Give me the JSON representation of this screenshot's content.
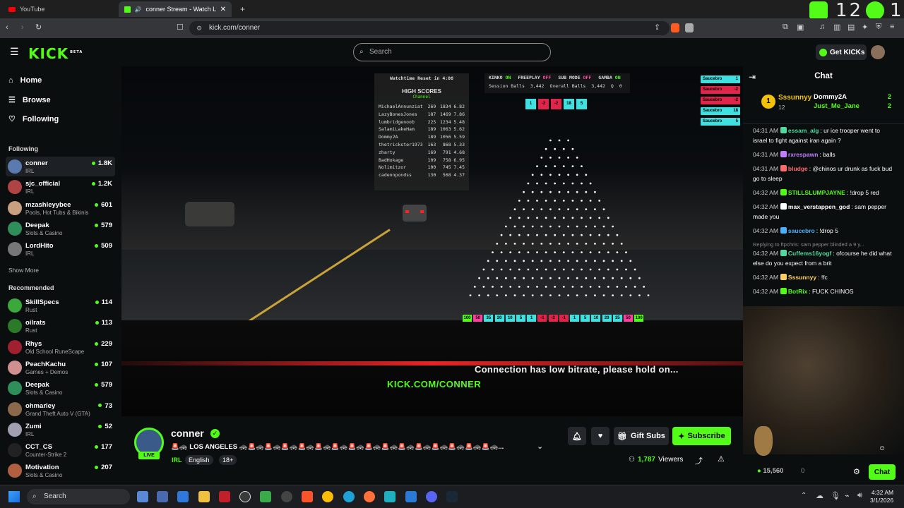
{
  "browser": {
    "tabs": [
      {
        "title": "YouTube"
      },
      {
        "title": "conner Stream - Watch Live o"
      }
    ],
    "new_tab": "+",
    "url": "kick.com/conner",
    "corner_counts": [
      "12",
      "1"
    ]
  },
  "kick": {
    "logo": "KICK",
    "beta": "BETA",
    "search_placeholder": "Search",
    "get_kicks": "Get KICKs"
  },
  "sidebar": {
    "nav": [
      {
        "label": "Home"
      },
      {
        "label": "Browse"
      },
      {
        "label": "Following"
      }
    ],
    "following_title": "Following",
    "following": [
      {
        "name": "conner",
        "category": "IRL",
        "viewers": "1.8K",
        "color": "#5a7ab0"
      },
      {
        "name": "sjc_official",
        "category": "IRL",
        "viewers": "1.2K",
        "color": "#b04444"
      },
      {
        "name": "mzashleyybee",
        "category": "Pools, Hot Tubs & Bikinis",
        "viewers": "601",
        "color": "#c8a080"
      },
      {
        "name": "Deepak",
        "category": "Slots & Casino",
        "viewers": "579",
        "color": "#2e8f5a"
      },
      {
        "name": "LordHito",
        "category": "IRL",
        "viewers": "509",
        "color": "#777"
      }
    ],
    "show_more": "Show More",
    "recommended_title": "Recommended",
    "recommended": [
      {
        "name": "SkillSpecs",
        "category": "Rust",
        "viewers": "114",
        "color": "#3aa83a"
      },
      {
        "name": "oilrats",
        "category": "Rust",
        "viewers": "113",
        "color": "#2a7a2a"
      },
      {
        "name": "Rhys",
        "category": "Old School RuneScape",
        "viewers": "229",
        "color": "#a02030"
      },
      {
        "name": "PeachKachu",
        "category": "Games + Demos",
        "viewers": "107",
        "color": "#d09090"
      },
      {
        "name": "Deepak",
        "category": "Slots & Casino",
        "viewers": "579",
        "color": "#2e8f5a"
      },
      {
        "name": "ohmarley",
        "category": "Grand Theft Auto V (GTA)",
        "viewers": "73",
        "color": "#8a6a4a"
      },
      {
        "name": "Zumi",
        "category": "IRL",
        "viewers": "52",
        "color": "#a0a0b0"
      },
      {
        "name": "CCT_CS",
        "category": "Counter-Strike 2",
        "viewers": "177",
        "color": "#222"
      },
      {
        "name": "Motivation",
        "category": "Slots & Casino",
        "viewers": "207",
        "color": "#b06040"
      }
    ]
  },
  "video": {
    "watchtime": "Watchtime Reset in 4:08",
    "flags": [
      {
        "label": "KINKO",
        "state": "ON",
        "color": "#53fc18"
      },
      {
        "label": "FREEPLAY",
        "state": "OFF",
        "color": "#ff4aa0"
      },
      {
        "label": "SUB MODE",
        "state": "OFF",
        "color": "#ff4aa0"
      },
      {
        "label": "GAMBA",
        "state": "ON",
        "color": "#53fc18"
      }
    ],
    "session_balls_label": "Session Balls",
    "session_balls": "3,442",
    "overall_balls_label": "Overall Balls",
    "overall_balls": "3,442",
    "q_label": "Q",
    "q_value": "0",
    "high_scores_title": "HIGH SCORES",
    "high_scores_sub": "Channel",
    "high_scores": [
      {
        "name": "MichaelAnnunziat",
        "a": "269",
        "b": "1834",
        "c": "6.82"
      },
      {
        "name": "LazyBonesJones",
        "a": "187",
        "b": "1469",
        "c": "7.86"
      },
      {
        "name": "lumbridgenoob",
        "a": "225",
        "b": "1234",
        "c": "5.48"
      },
      {
        "name": "SalamiLakeHam",
        "a": "189",
        "b": "1063",
        "c": "5.62"
      },
      {
        "name": "Dommy2A",
        "a": "189",
        "b": "1056",
        "c": "5.59"
      },
      {
        "name": "thetrickster1973",
        "a": "163",
        "b": "868",
        "c": "5.33"
      },
      {
        "name": "zharty",
        "a": "169",
        "b": "791",
        "c": "4.68"
      },
      {
        "name": "BadHokage",
        "a": "109",
        "b": "758",
        "c": "6.95"
      },
      {
        "name": "Nolimitzor",
        "a": "100",
        "b": "745",
        "c": "7.45"
      },
      {
        "name": "cadennpondss",
        "a": "130",
        "b": "568",
        "c": "4.37"
      }
    ],
    "drop_chips": [
      {
        "v": "1",
        "color": "#3ee0e0"
      },
      {
        "v": "-2",
        "color": "#e0244a"
      },
      {
        "v": "-2",
        "color": "#e0244a"
      },
      {
        "v": "18",
        "color": "#3ee0e0"
      },
      {
        "v": "5",
        "color": "#3ee0e0"
      }
    ],
    "recent": [
      {
        "name": "Saucebro",
        "v": "1",
        "color": "#3ee0e0"
      },
      {
        "name": "Saucebro",
        "v": "-2",
        "color": "#e0244a"
      },
      {
        "name": "Saucebro",
        "v": "-2",
        "color": "#e0244a"
      },
      {
        "name": "Saucebro",
        "v": "18",
        "color": "#3ee0e0"
      },
      {
        "name": "Saucebro",
        "v": "5",
        "color": "#3ee0e0"
      }
    ],
    "slots": [
      {
        "v": "100",
        "color": "#53fc18"
      },
      {
        "v": "50",
        "color": "#ff3fa0"
      },
      {
        "v": "35",
        "color": "#3ee0e0"
      },
      {
        "v": "20",
        "color": "#3ee0e0"
      },
      {
        "v": "10",
        "color": "#3ee0e0"
      },
      {
        "v": "5",
        "color": "#3ee0e0"
      },
      {
        "v": "1",
        "color": "#3ee0e0"
      },
      {
        "v": "-1",
        "color": "#e0244a"
      },
      {
        "v": "-2",
        "color": "#e0244a"
      },
      {
        "v": "-1",
        "color": "#e0244a"
      },
      {
        "v": "1",
        "color": "#3ee0e0"
      },
      {
        "v": "5",
        "color": "#3ee0e0"
      },
      {
        "v": "10",
        "color": "#3ee0e0"
      },
      {
        "v": "20",
        "color": "#3ee0e0"
      },
      {
        "v": "35",
        "color": "#3ee0e0"
      },
      {
        "v": "50",
        "color": "#ff3fa0"
      },
      {
        "v": "100",
        "color": "#53fc18"
      }
    ],
    "status_text": "Connection has low bitrate, please hold on...",
    "watermark": "KICK.COM/CONNER"
  },
  "channel": {
    "name": "conner",
    "live": "LIVE",
    "title": "🚨🚓 LOS ANGELES 🚓🚨🚓🚨🚓🚨🚓🚨🚓🚨🚓🚨🚓🚨🚓🚨🚓🚨🚓🚨🚓🚨🚓🚨🚓🚨🚓🚨🚓🚨🚓...",
    "tags": [
      "IRL",
      "English",
      "18+"
    ],
    "viewers": "1,787",
    "viewers_label": "Viewers",
    "gift_subs": "Gift Subs",
    "subscribe": "Subscribe"
  },
  "chat": {
    "title": "Chat",
    "leader": {
      "rank": "1",
      "name": "Sssunnyy",
      "count": "12"
    },
    "gifters": [
      {
        "name": "Dommy2A",
        "count": "2"
      },
      {
        "name": "Just_Me_Jane",
        "count": "2"
      }
    ],
    "messages": [
      {
        "time": "04:31 AM",
        "user": "essam_alg",
        "color": "#53d8a0",
        "text": "ur ice trooper went to israel to fight against iran again ?"
      },
      {
        "time": "04:31 AM",
        "user": "rxrespawn",
        "color": "#c27cff",
        "text": "balls"
      },
      {
        "time": "04:31 AM",
        "user": "bludge",
        "color": "#ff6a6a",
        "text": "@chinos ur drunk as fuck bud go to sleep"
      },
      {
        "time": "04:32 AM",
        "user": "STILLSLUMPJAYNE",
        "color": "#53fc18",
        "text": "!drop 5 red"
      },
      {
        "time": "04:32 AM",
        "user": "max_verstappen_god",
        "color": "#fff",
        "text": "sam pepper made you"
      },
      {
        "time": "04:32 AM",
        "user": "saucebro",
        "color": "#4ab0ff",
        "text": "!drop 5"
      },
      {
        "time": "04:32 AM",
        "user": "Cuffems16yogf",
        "color": "#53d8a0",
        "text": "ofcourse he did what else do you expect from a brit",
        "reply": "Replying to ftpchris: sam pepper blinded a 9 y..."
      },
      {
        "time": "04:32 AM",
        "user": "Sssunnyy",
        "color": "#ffcc66",
        "text": "!fc"
      },
      {
        "time": "04:32 AM",
        "user": "BotRix",
        "color": "#53fc18",
        "text": "FUCK CHINOS"
      }
    ],
    "points": "15,560",
    "points2": "0",
    "chat_button": "Chat"
  },
  "taskbar": {
    "search": "Search",
    "time": "4:32 AM",
    "date": "3/1/2026"
  }
}
